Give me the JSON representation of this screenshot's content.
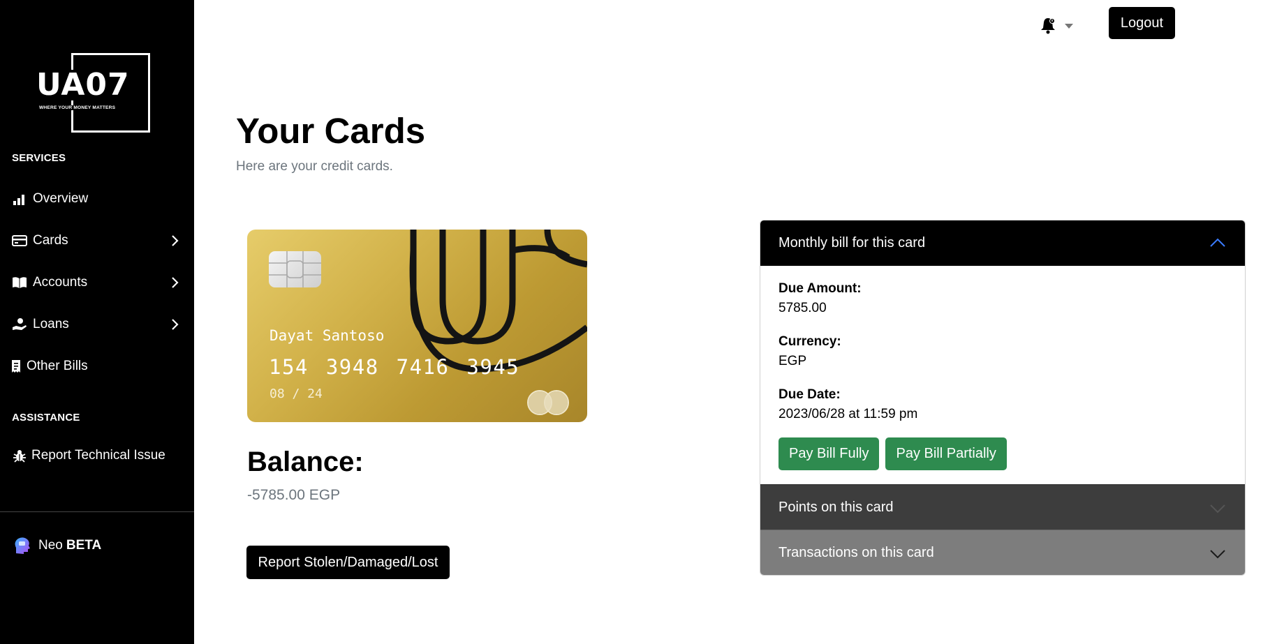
{
  "brand": {
    "logo_text": "UA07",
    "tagline": "WHERE YOUR MONEY MATTERS"
  },
  "sidebar": {
    "services_label": "SERVICES",
    "items": [
      {
        "label": "Overview",
        "icon": "bar-chart-icon"
      },
      {
        "label": "Cards",
        "icon": "credit-card-icon",
        "expandable": true
      },
      {
        "label": "Accounts",
        "icon": "book-icon",
        "expandable": true
      },
      {
        "label": "Loans",
        "icon": "hand-money-icon",
        "expandable": true
      },
      {
        "label": "Other Bills",
        "icon": "receipt-icon"
      }
    ],
    "assistance_label": "ASSISTANCE",
    "assistance_items": [
      {
        "label": "Report Technical Issue",
        "icon": "bug-icon"
      }
    ],
    "neo": {
      "name": "Neo",
      "badge": "BETA",
      "icon": "ai-head-icon"
    }
  },
  "topbar": {
    "notifications_icon": "bell-icon",
    "logout_label": "Logout"
  },
  "page": {
    "title": "Your Cards",
    "subtitle": "Here are your credit cards."
  },
  "card": {
    "holder": "Dayat Santoso",
    "number": "154 3948 7416 3945",
    "expiry": "08 / 24",
    "colors": {
      "gold_light": "#e6cc6a",
      "gold_dark": "#a8862a"
    }
  },
  "balance": {
    "label": "Balance:",
    "value": "-5785.00 EGP"
  },
  "report_button": "Report Stolen/Damaged/Lost",
  "accordion": {
    "monthly": {
      "title": "Monthly bill for this card",
      "due_amount_label": "Due Amount:",
      "due_amount": "5785.00",
      "currency_label": "Currency:",
      "currency": "EGP",
      "due_date_label": "Due Date:",
      "due_date": "2023/06/28 at 11:59 pm",
      "pay_full_label": "Pay Bill Fully",
      "pay_partial_label": "Pay Bill Partially"
    },
    "points_title": "Points on this card",
    "transactions_title": "Transactions on this card"
  },
  "colors": {
    "accent_green": "#2e8b4f",
    "sidebar_bg": "#000000",
    "chevron_blue": "#3b7cff"
  }
}
